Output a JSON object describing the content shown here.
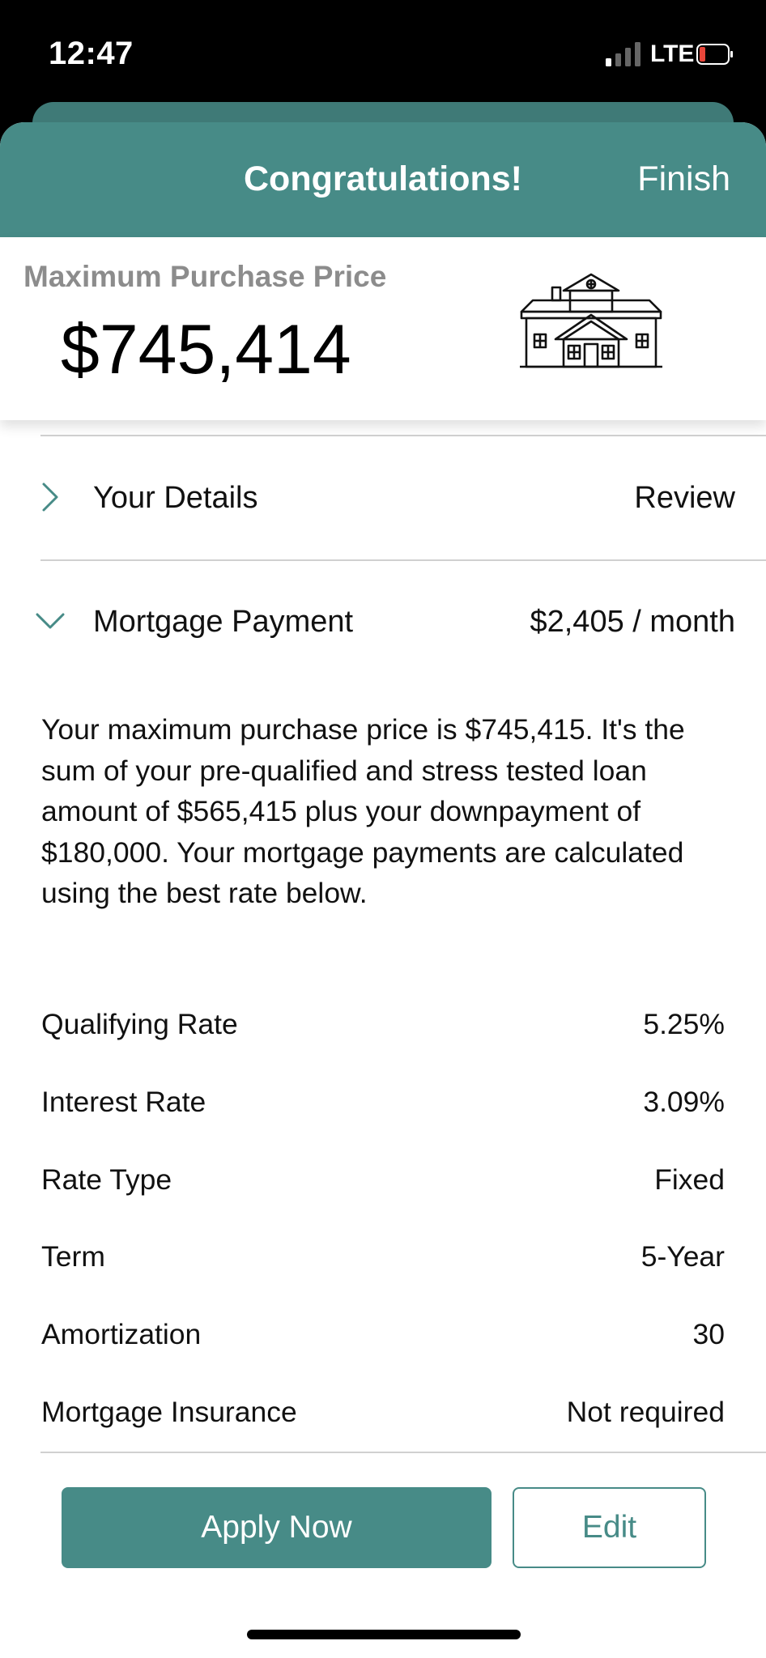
{
  "status": {
    "time": "12:47",
    "network": "LTE"
  },
  "header": {
    "title": "Congratulations!",
    "finish_label": "Finish"
  },
  "summary": {
    "label": "Maximum Purchase Price",
    "value": "$745,414"
  },
  "sections": {
    "details": {
      "title": "Your Details",
      "action": "Review"
    },
    "mortgage": {
      "title": "Mortgage Payment",
      "amount": "$2,405 / month"
    }
  },
  "description": "Your maximum purchase price is $745,415. It's the sum of your pre-qualified and stress tested loan amount of $565,415 plus your downpayment of $180,000. Your mortgage payments are calculated using the best rate below.",
  "rates": [
    {
      "label": "Qualifying Rate",
      "value": "5.25%"
    },
    {
      "label": "Interest Rate",
      "value": "3.09%"
    },
    {
      "label": "Rate Type",
      "value": "Fixed"
    },
    {
      "label": "Term",
      "value": "5-Year"
    },
    {
      "label": "Amortization",
      "value": "30"
    },
    {
      "label": "Mortgage Insurance",
      "value": "Not required"
    }
  ],
  "buttons": {
    "apply": "Apply Now",
    "edit": "Edit"
  },
  "colors": {
    "accent": "#478b87",
    "accent_dark": "#3f7a77",
    "battery_low": "#e8463a"
  }
}
